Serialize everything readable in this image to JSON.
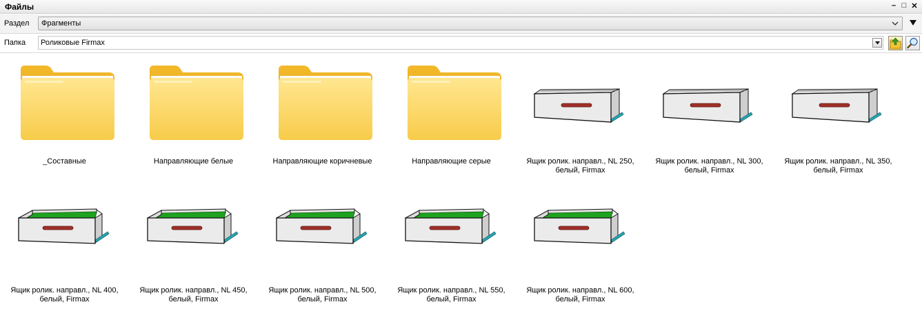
{
  "window": {
    "title": "Файлы",
    "controls": [
      "–",
      "□",
      "✕"
    ]
  },
  "section": {
    "label": "Раздел",
    "value": "Фрагменты"
  },
  "folder": {
    "label": "Папка",
    "value": "Роликовые Firmax"
  },
  "items": [
    {
      "type": "folder",
      "name": "_Составные"
    },
    {
      "type": "folder",
      "name": "Направляющие белые"
    },
    {
      "type": "folder",
      "name": "Направляющие коричневые"
    },
    {
      "type": "folder",
      "name": "Направляющие серые"
    },
    {
      "type": "drawer",
      "line1": "Ящик ролик. направл., NL 250,",
      "line2": "белый, Firmax"
    },
    {
      "type": "drawer",
      "line1": "Ящик ролик. направл., NL 300,",
      "line2": "белый, Firmax"
    },
    {
      "type": "drawer",
      "line1": "Ящик ролик. направл., NL 350,",
      "line2": "белый, Firmax"
    },
    {
      "type": "drawer_open",
      "line1": "Ящик ролик. направл., NL 400,",
      "line2": "белый, Firmax"
    },
    {
      "type": "drawer_open",
      "line1": "Ящик ролик. направл., NL 450,",
      "line2": "белый, Firmax"
    },
    {
      "type": "drawer_open",
      "line1": "Ящик ролик. направл., NL 500,",
      "line2": "белый, Firmax"
    },
    {
      "type": "drawer_open",
      "line1": "Ящик ролик. направл., NL 550,",
      "line2": "белый, Firmax"
    },
    {
      "type": "drawer_open",
      "line1": "Ящик ролик. направл., NL 600,",
      "line2": "белый, Firmax"
    }
  ],
  "colors": {
    "folder": "#F5C542",
    "drawer_front": "#E8E8E8",
    "drawer_bottom": "#1FA21F",
    "handle": "#A0302A",
    "slide": "#2AA3B0"
  }
}
